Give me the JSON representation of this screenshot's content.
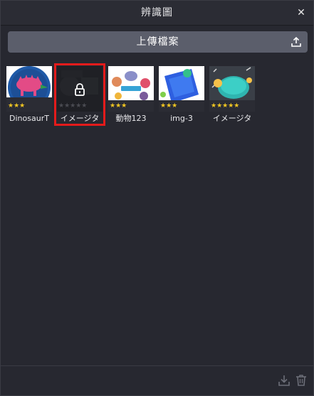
{
  "window": {
    "title": "辨識圖",
    "close_icon": "close-icon"
  },
  "upload": {
    "label": "上傳檔案",
    "icon": "upload-icon"
  },
  "colors": {
    "accent_red": "#e41b1b",
    "star": "#f3c622",
    "button_bg": "#5b5e6b"
  },
  "items": [
    {
      "label": "DinosaurT",
      "stars_filled": 3,
      "stars_total": 3,
      "locked": false,
      "thumb": "dinosaur-thumbnail"
    },
    {
      "label": "イメージタ",
      "stars_filled": 0,
      "stars_total": 5,
      "locked": true,
      "thumb": "locked-thumbnail"
    },
    {
      "label": "動物123",
      "stars_filled": 3,
      "stars_total": 3,
      "locked": false,
      "thumb": "animals-thumbnail"
    },
    {
      "label": "img-3",
      "stars_filled": 3,
      "stars_total": 3,
      "locked": false,
      "thumb": "ar-thumbnail"
    },
    {
      "label": "イメージタ",
      "stars_filled": 5,
      "stars_total": 5,
      "locked": false,
      "thumb": "scratch-thumbnail"
    }
  ],
  "footer": {
    "download_icon": "download-icon",
    "trash_icon": "trash-icon"
  }
}
